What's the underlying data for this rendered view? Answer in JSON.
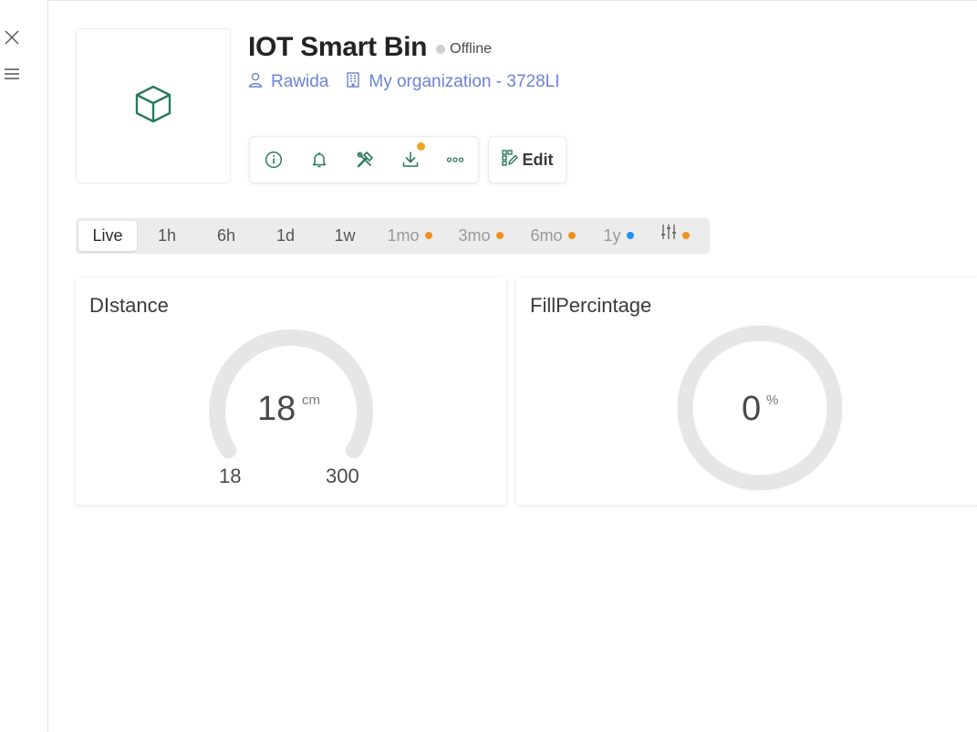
{
  "rail": {
    "close_icon": "close-icon",
    "menu_icon": "menu-icon"
  },
  "device": {
    "title": "IOT Smart Bin",
    "status": "Offline",
    "status_color": "#cfcfcf",
    "icon": "cube-icon",
    "owner": "Rawida",
    "organization": "My organization - 3728LI"
  },
  "toolbar": {
    "info_icon": "info-icon",
    "bell_icon": "bell-icon",
    "tools_icon": "tools-icon",
    "download_icon": "download-icon",
    "more_icon": "more-icon",
    "edit_label": "Edit"
  },
  "time_ranges": [
    {
      "label": "Live",
      "active": true
    },
    {
      "label": "1h"
    },
    {
      "label": "6h"
    },
    {
      "label": "1d"
    },
    {
      "label": "1w"
    },
    {
      "label": "1mo",
      "badge_color": "#f0921b"
    },
    {
      "label": "3mo",
      "badge_color": "#f0921b"
    },
    {
      "label": "6mo",
      "badge_color": "#f0921b"
    },
    {
      "label": "1y",
      "badge_color": "#1e90ff"
    },
    {
      "label": "",
      "icon": "sliders-icon",
      "badge_color": "#f0921b"
    }
  ],
  "widgets": {
    "distance": {
      "title": "DIstance",
      "value": "18",
      "unit": "cm",
      "min": "18",
      "max": "300"
    },
    "fill": {
      "title": "FillPercintage",
      "value": "0",
      "unit": "%"
    }
  },
  "colors": {
    "accent_green": "#2a7a5a",
    "link_blue": "#6b82d6",
    "gauge_track": "#e6e6e6"
  }
}
